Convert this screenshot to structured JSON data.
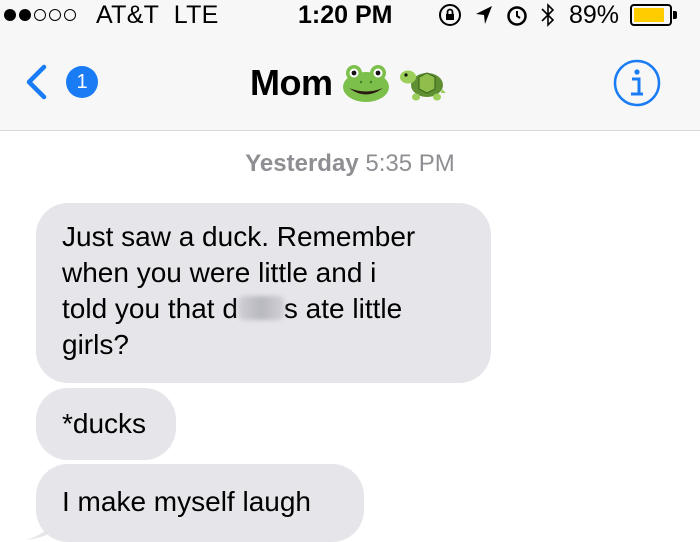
{
  "status_bar": {
    "carrier": "AT&T",
    "network": "LTE",
    "time": "1:20 PM",
    "battery_percent": "89%",
    "battery_level": 0.89,
    "signal_bars_filled": 2,
    "signal_bars_total": 5,
    "battery_color": "#ffcc00"
  },
  "nav": {
    "back_badge": "1",
    "contact_name": "Mom",
    "contact_emoji": [
      "frog-icon",
      "turtle-icon"
    ],
    "accent_color": "#1a7cf5"
  },
  "conversation": {
    "timestamp_day": "Yesterday",
    "timestamp_time": "5:35 PM",
    "messages": [
      {
        "line1": "Just saw a duck. Remember",
        "line2": "when you were little and i",
        "line3_pre": "told you that d",
        "line3_post": "s ate little",
        "line4": "girls?"
      },
      {
        "text": "*ducks"
      },
      {
        "text": "I make myself laugh"
      }
    ],
    "bubble_color": "#e5e5ea"
  }
}
